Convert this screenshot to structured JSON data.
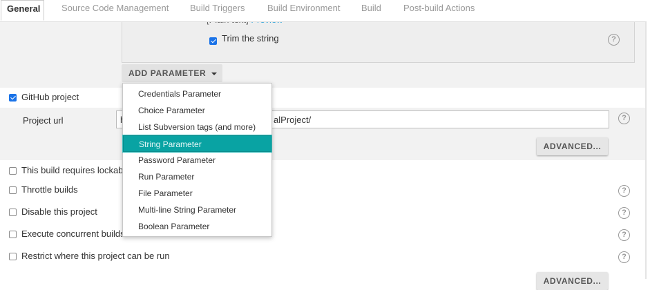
{
  "tabs": [
    {
      "label": "General"
    },
    {
      "label": "Source Code Management"
    },
    {
      "label": "Build Triggers"
    },
    {
      "label": "Build Environment"
    },
    {
      "label": "Build"
    },
    {
      "label": "Post-build Actions"
    }
  ],
  "string_param": {
    "preview_prefix": "[Plain text]",
    "preview_link": "Preview",
    "trim_label": "Trim the string",
    "trim_checked": true
  },
  "add_parameter": {
    "label": "ADD PARAMETER",
    "menu": [
      {
        "label": "Credentials Parameter"
      },
      {
        "label": "Choice Parameter"
      },
      {
        "label": "List Subversion tags (and more)"
      },
      {
        "label": "String Parameter"
      },
      {
        "label": "Password Parameter"
      },
      {
        "label": "Run Parameter"
      },
      {
        "label": "File Parameter"
      },
      {
        "label": "Multi-line String Parameter"
      },
      {
        "label": "Boolean Parameter"
      }
    ],
    "selected": "String Parameter"
  },
  "github": {
    "label": "GitHub project",
    "checked": true,
    "project_url_label": "Project url",
    "project_url_value_start": "h",
    "project_url_value_end": "alProject/",
    "advanced_label": "ADVANCED..."
  },
  "options": [
    {
      "label": "This build requires lockab",
      "checked": false
    },
    {
      "label": "Throttle builds",
      "checked": false
    },
    {
      "label": "Disable this project",
      "checked": false
    },
    {
      "label": "Execute concurrent builds",
      "checked": false
    },
    {
      "label": "Restrict where this project can be run",
      "checked": false
    }
  ],
  "bottom_advanced_label": "ADVANCED...",
  "help_glyph": "?",
  "colors": {
    "selected_item": "#09a3a3",
    "link": "#3ba7d9",
    "checkbox": "#1a73e8"
  }
}
